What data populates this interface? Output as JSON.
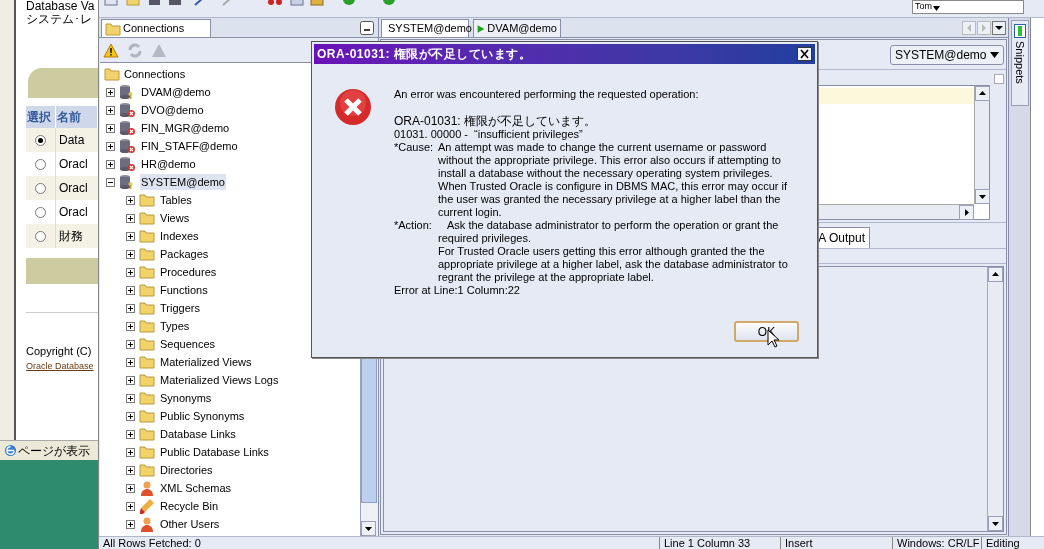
{
  "browser_window": {
    "heading_lines": [
      "Database Va",
      "システム･レ"
    ],
    "table": {
      "columns": [
        "選択",
        "名前"
      ],
      "rows": [
        {
          "selected": true,
          "name": "Data"
        },
        {
          "selected": false,
          "name": "Oracl"
        },
        {
          "selected": false,
          "name": "Oracl"
        },
        {
          "selected": false,
          "name": "Oracl"
        },
        {
          "selected": false,
          "name": "財務"
        }
      ]
    },
    "copyright": "Copyright (C)",
    "link": "Oracle Database",
    "status": "ページが表示"
  },
  "toolbar": {
    "user_combo": "Tom"
  },
  "connections_panel": {
    "tab": "Connections",
    "tree": {
      "label": "Connections",
      "children": [
        {
          "label": "DVAM@demo",
          "kind": "connection",
          "error": false,
          "expanded": false,
          "selected": false
        },
        {
          "label": "DVO@demo",
          "kind": "connection",
          "error": true,
          "expanded": false,
          "selected": false
        },
        {
          "label": "FIN_MGR@demo",
          "kind": "connection",
          "error": true,
          "expanded": false,
          "selected": false
        },
        {
          "label": "FIN_STAFF@demo",
          "kind": "connection",
          "error": true,
          "expanded": false,
          "selected": false
        },
        {
          "label": "HR@demo",
          "kind": "connection",
          "error": true,
          "expanded": false,
          "selected": false
        },
        {
          "label": "SYSTEM@demo",
          "kind": "connection",
          "error": false,
          "expanded": true,
          "selected": true,
          "children": [
            {
              "label": "Tables",
              "kind": "folder",
              "expanded": false
            },
            {
              "label": "Views",
              "kind": "folder",
              "expanded": false
            },
            {
              "label": "Indexes",
              "kind": "folder",
              "expanded": false
            },
            {
              "label": "Packages",
              "kind": "folder",
              "expanded": false
            },
            {
              "label": "Procedures",
              "kind": "folder",
              "expanded": false
            },
            {
              "label": "Functions",
              "kind": "folder",
              "expanded": false
            },
            {
              "label": "Triggers",
              "kind": "folder",
              "expanded": false
            },
            {
              "label": "Types",
              "kind": "folder",
              "expanded": false
            },
            {
              "label": "Sequences",
              "kind": "folder",
              "expanded": false
            },
            {
              "label": "Materialized Views",
              "kind": "folder",
              "expanded": false
            },
            {
              "label": "Materialized Views Logs",
              "kind": "folder",
              "expanded": false
            },
            {
              "label": "Synonyms",
              "kind": "folder",
              "expanded": false
            },
            {
              "label": "Public Synonyms",
              "kind": "folder",
              "expanded": false
            },
            {
              "label": "Database Links",
              "kind": "folder",
              "expanded": false
            },
            {
              "label": "Public Database Links",
              "kind": "folder",
              "expanded": false
            },
            {
              "label": "Directories",
              "kind": "folder",
              "expanded": false
            },
            {
              "label": "XML Schemas",
              "kind": "person",
              "expanded": false
            },
            {
              "label": "Recycle Bin",
              "kind": "eraser",
              "expanded": false
            },
            {
              "label": "Other Users",
              "kind": "person",
              "expanded": false
            }
          ]
        }
      ]
    }
  },
  "editor": {
    "tabs": [
      {
        "label": "SYSTEM@demo",
        "selected": true
      },
      {
        "label": "DVAM@demo",
        "selected": false
      }
    ],
    "connection_select": "SYSTEM@demo",
    "checkbox": {
      "checked": false
    },
    "results_tabs": [
      {
        "label": "A Output",
        "selected": true
      }
    ]
  },
  "side_panel": {
    "label": "Snippets"
  },
  "status_bar": [
    "All Rows Fetched: 0",
    "Line 1 Column 33",
    "Insert",
    "Windows: CR/LF",
    "Editing"
  ],
  "dialog": {
    "title": "ORA-01031: 権限が不足しています。",
    "intro": "An error was encountered performing the requested operation:",
    "code_line": "ORA-01031: 権限が不足しています。",
    "reason_line": "01031. 00000 -  “insufficient privileges”",
    "sections": [
      {
        "label": "*Cause:",
        "paragraphs": [
          "An attempt was made to change the current username or password without the appropriate privilege. This error also occurs if attempting to install a database without the necessary operating system privileges.",
          "When Trusted Oracle is configure in DBMS MAC, this error may occur if the user was granted the necessary privilege at a higher label than the current login."
        ]
      },
      {
        "label": "*Action:",
        "paragraphs": [
          "Ask the database administrator to perform the operation or grant the required privileges.",
          "For Trusted Oracle users getting this error although granted the the appropriate privilege at a higher label, ask the database administrator to regrant the privilege at the appropriate label."
        ]
      }
    ],
    "footer": "Error at Line:1 Column:22",
    "button": "OK"
  }
}
